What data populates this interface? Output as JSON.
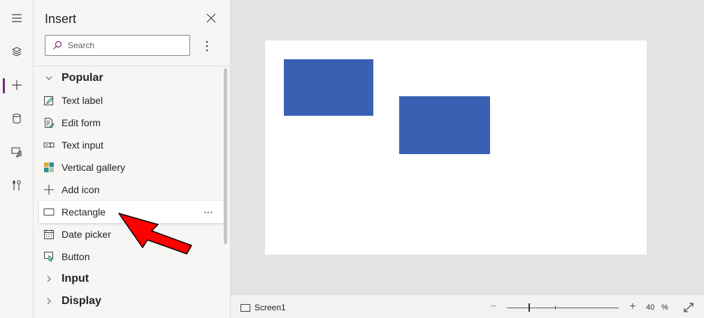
{
  "insert_pane": {
    "title": "Insert",
    "search_placeholder": "Search",
    "sections": [
      {
        "label": "Popular",
        "expanded": true,
        "icon": "chevron-down-icon"
      },
      {
        "label": "Input",
        "expanded": false,
        "icon": "chevron-right-icon"
      },
      {
        "label": "Display",
        "expanded": false,
        "icon": "chevron-right-icon"
      }
    ],
    "items": [
      {
        "label": "Text label",
        "icon": "text-label-icon"
      },
      {
        "label": "Edit form",
        "icon": "edit-form-icon"
      },
      {
        "label": "Text input",
        "icon": "text-input-icon"
      },
      {
        "label": "Vertical gallery",
        "icon": "vertical-gallery-icon"
      },
      {
        "label": "Add icon",
        "icon": "add-icon"
      },
      {
        "label": "Rectangle",
        "icon": "rectangle-icon",
        "more": "⋯"
      },
      {
        "label": "Date picker",
        "icon": "date-picker-icon"
      },
      {
        "label": "Button",
        "icon": "button-icon"
      }
    ]
  },
  "left_rail": {
    "icons": [
      "hamburger-menu-icon",
      "tree-view-layers-icon",
      "insert-plus-icon",
      "data-cylinder-icon",
      "media-icon",
      "tools-icon"
    ],
    "active": "insert-plus-icon",
    "accent_color": "#742774"
  },
  "canvas": {
    "background_color": "#e3e3e3",
    "screen_color": "#ffffff",
    "shape_color": "#3a60b3"
  },
  "status_bar": {
    "screen_name": "Screen1",
    "zoom_minus": "−",
    "zoom_plus": "+",
    "zoom_value": "40",
    "zoom_unit": "%"
  },
  "annotation": {
    "type": "red-arrow",
    "points_to": "Rectangle",
    "color": "#ff0000"
  }
}
